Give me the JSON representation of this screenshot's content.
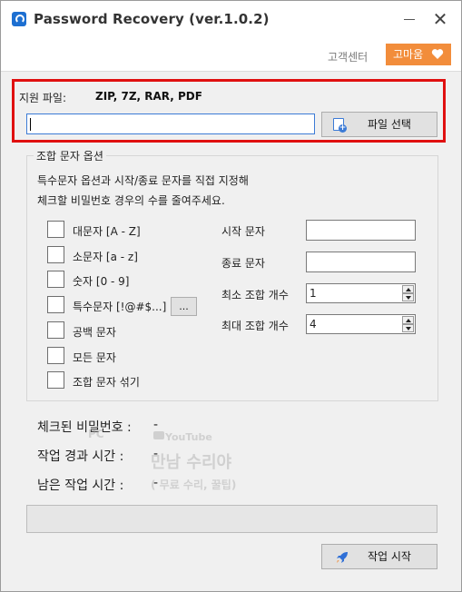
{
  "window": {
    "title": "Password Recovery (ver.1.0.2)"
  },
  "header": {
    "customer_center": "고객센터",
    "thanks_button": "고마움"
  },
  "support": {
    "label": "지원 파일:",
    "formats": "ZIP, 7Z, RAR, PDF"
  },
  "file": {
    "input_value": "",
    "select_button": "파일 선택"
  },
  "options": {
    "group_title": "조합 문자 옵션",
    "desc_line1": "특수문자 옵션과 시작/종료 문자를 직접 지정해",
    "desc_line2": "체크할 비밀번호 경우의 수를 줄여주세요.",
    "checkboxes": [
      {
        "label": "대문자 [A - Z]",
        "checked": false
      },
      {
        "label": "소문자 [a - z]",
        "checked": false
      },
      {
        "label": "숫자 [0 - 9]",
        "checked": false
      },
      {
        "label": "특수문자 [!@#$...]",
        "checked": false
      },
      {
        "label": "공백 문자",
        "checked": false
      },
      {
        "label": "모든 문자",
        "checked": false
      },
      {
        "label": "조합 문자 섞기",
        "checked": false
      }
    ],
    "special_button": "...",
    "start_char_label": "시작 문자",
    "start_char_value": "",
    "end_char_label": "종료 문자",
    "end_char_value": "",
    "min_label": "최소 조합 개수",
    "min_value": "1",
    "max_label": "최대 조합 개수",
    "max_value": "4"
  },
  "stats": {
    "checked_label": "체크된 비밀번호 :",
    "checked_value": "-",
    "elapsed_label": "작업 경과 시간 :",
    "elapsed_value": "-",
    "remaining_label": "남은 작업 시간 :",
    "remaining_value": "-"
  },
  "watermark": {
    "pc": "PC",
    "youtube": "YouTube",
    "brand": "만남 수리야",
    "tagline": "( 무료 수리, 꿀팁)"
  },
  "progress": {
    "percent": 0
  },
  "actions": {
    "start_button": "작업 시작"
  },
  "colors": {
    "accent_orange": "#f28d3b",
    "highlight_red": "#e01010",
    "input_focus_blue": "#3c7bd6"
  }
}
